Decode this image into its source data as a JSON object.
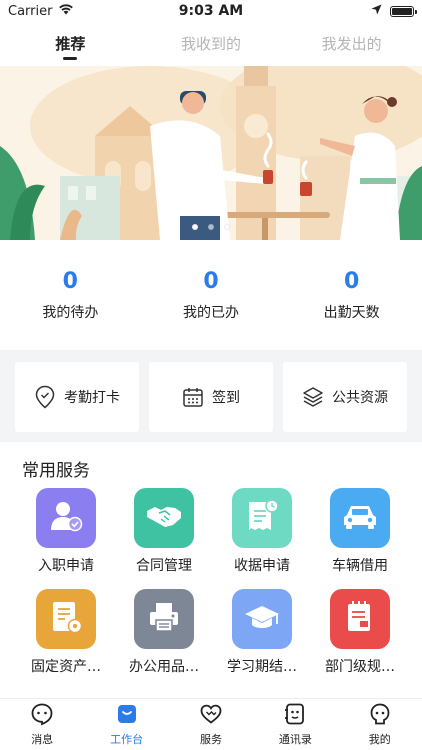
{
  "status": {
    "carrier": "Carrier",
    "time": "9:03 AM"
  },
  "tabs": [
    {
      "label": "推荐",
      "active": true
    },
    {
      "label": "我收到的",
      "active": false
    },
    {
      "label": "我发出的",
      "active": false
    }
  ],
  "banner": {
    "slide_count": 3,
    "active_slide": 1
  },
  "stats": [
    {
      "value": "0",
      "label": "我的待办"
    },
    {
      "value": "0",
      "label": "我的已办"
    },
    {
      "value": "0",
      "label": "出勤天数"
    }
  ],
  "quick_actions": [
    {
      "label": "考勤打卡",
      "icon": "location-check-icon"
    },
    {
      "label": "签到",
      "icon": "calendar-icon"
    },
    {
      "label": "公共资源",
      "icon": "layers-icon"
    }
  ],
  "services": {
    "title": "常用服务",
    "items": [
      {
        "label": "入职申请",
        "icon": "user-check-icon",
        "color": "#8b7ef0"
      },
      {
        "label": "合同管理",
        "icon": "handshake-icon",
        "color": "#3fc2a2"
      },
      {
        "label": "收据申请",
        "icon": "receipt-icon",
        "color": "#6fdac4"
      },
      {
        "label": "车辆借用",
        "icon": "car-icon",
        "color": "#4aaaf2"
      },
      {
        "label": "固定资产…",
        "icon": "asset-document-icon",
        "color": "#e8a63a"
      },
      {
        "label": "办公用品…",
        "icon": "printer-icon",
        "color": "#7d8796"
      },
      {
        "label": "学习期结…",
        "icon": "graduation-cap-icon",
        "color": "#7da6f5"
      },
      {
        "label": "部门级规…",
        "icon": "notebook-icon",
        "color": "#ea4b4b"
      }
    ]
  },
  "bottom_nav": [
    {
      "label": "消息",
      "icon": "message-icon",
      "active": false
    },
    {
      "label": "工作台",
      "icon": "workbench-icon",
      "active": true
    },
    {
      "label": "服务",
      "icon": "heart-icon",
      "active": false
    },
    {
      "label": "通讯录",
      "icon": "contacts-icon",
      "active": false
    },
    {
      "label": "我的",
      "icon": "profile-icon",
      "active": false
    }
  ],
  "colors": {
    "accent": "#2b7be8"
  }
}
